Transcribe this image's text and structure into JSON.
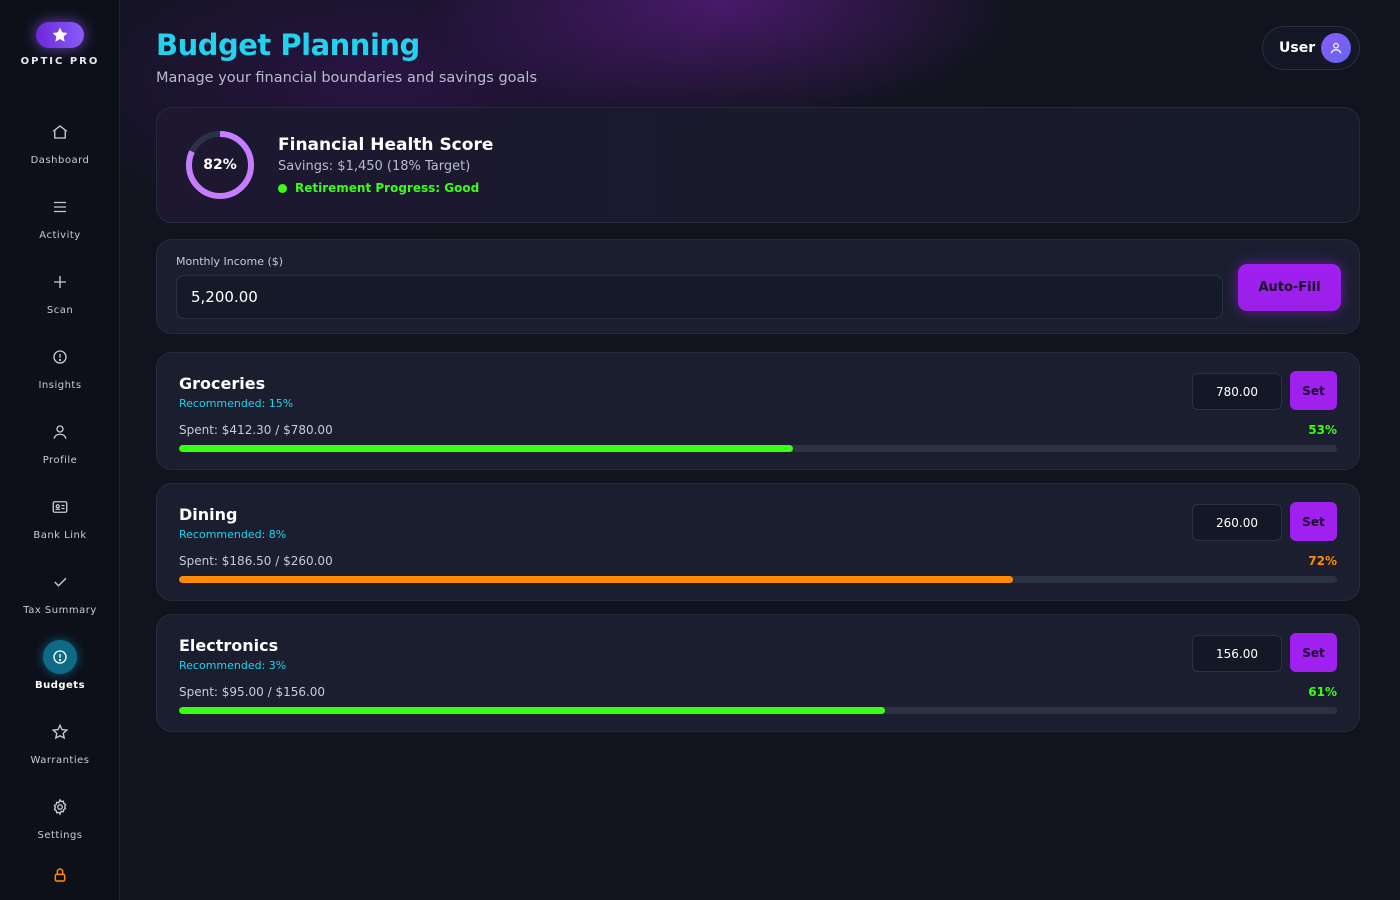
{
  "app": {
    "brand": "OPTIC PRO"
  },
  "sidebar": {
    "items": [
      {
        "label": "Dashboard",
        "icon": "home-icon"
      },
      {
        "label": "Activity",
        "icon": "menu-icon"
      },
      {
        "label": "Scan",
        "icon": "plus-icon"
      },
      {
        "label": "Insights",
        "icon": "info-icon"
      },
      {
        "label": "Profile",
        "icon": "user-icon"
      },
      {
        "label": "Bank Link",
        "icon": "id-card-icon"
      },
      {
        "label": "Tax Summary",
        "icon": "check-icon"
      },
      {
        "label": "Budgets",
        "icon": "info-icon",
        "active": true
      },
      {
        "label": "Warranties",
        "icon": "star-icon"
      },
      {
        "label": "Settings",
        "icon": "gear-icon"
      }
    ],
    "footer_icon": "lock-icon"
  },
  "header": {
    "title": "Budget Planning",
    "subtitle": "Manage your financial boundaries and savings goals",
    "user_label": "User"
  },
  "health": {
    "score_label": "82%",
    "score": 0.82,
    "title": "Financial Health Score",
    "savings": "Savings: $1,450 (18% Target)",
    "status": "Retirement Progress: Good"
  },
  "income": {
    "label": "Monthly Income ($)",
    "value": "5,200.00",
    "autofill_label": "Auto-Fill"
  },
  "budgets": [
    {
      "name": "Groceries",
      "recommended": "Recommended: 15%",
      "limit_value": "780.00",
      "set_label": "Set",
      "spent": "Spent: $412.30 / $780.00",
      "percent_label": "53%",
      "progress": 0.53,
      "color": "#39ff14"
    },
    {
      "name": "Dining",
      "recommended": "Recommended: 8%",
      "limit_value": "260.00",
      "set_label": "Set",
      "spent": "Spent: $186.50 / $260.00",
      "percent_label": "72%",
      "progress": 0.72,
      "color": "#ff8c00"
    },
    {
      "name": "Electronics",
      "recommended": "Recommended: 3%",
      "limit_value": "156.00",
      "set_label": "Set",
      "spent": "Spent: $95.00 / $156.00",
      "percent_label": "61%",
      "progress": 0.61,
      "color": "#39ff14"
    }
  ],
  "colors": {
    "accent": "#22d3ee",
    "primary": "#a020f0",
    "success": "#39ff14",
    "warning": "#ff8c00"
  }
}
